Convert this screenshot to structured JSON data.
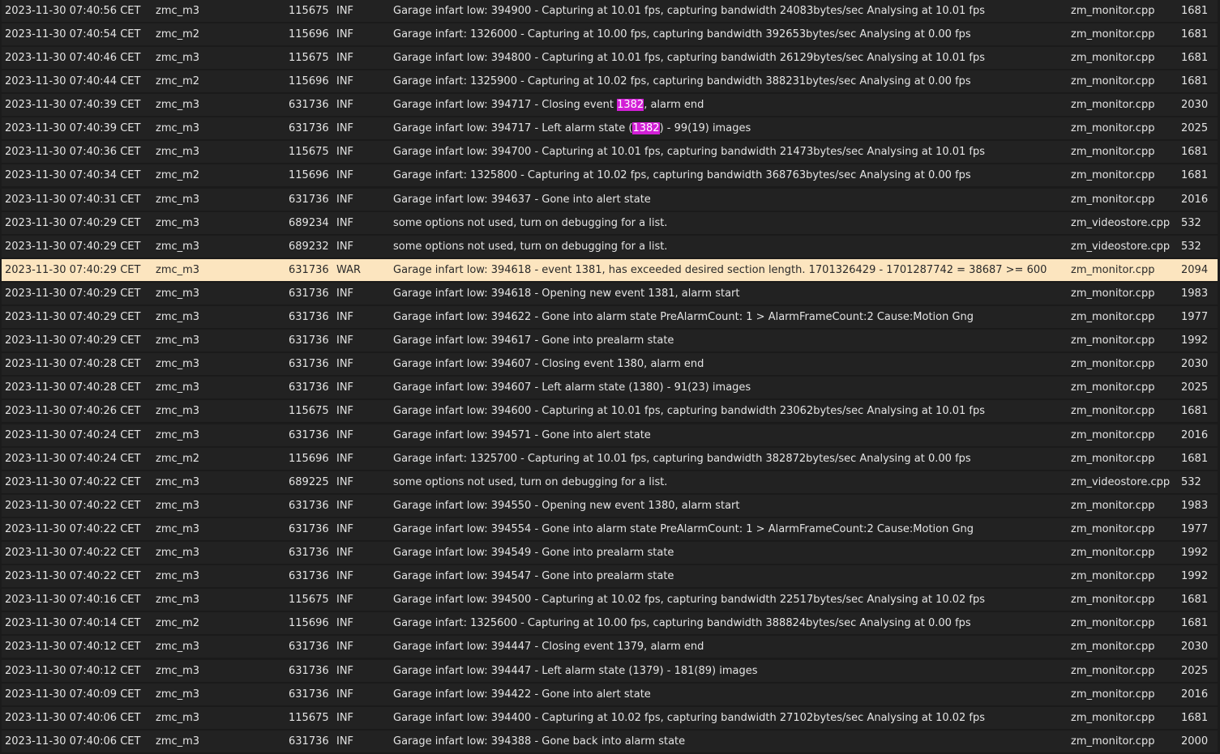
{
  "log": {
    "highlight_term": "1382",
    "highlight_color": "#d21fd6",
    "warning_row_color": "#fce5bf",
    "rows": [
      {
        "time": "2023-11-30 07:40:56 CET",
        "component": "zmc_m3",
        "pid": "115675",
        "level": "INF",
        "pre": "Garage infart low: 394900 - Capturing at 10.01 fps, capturing bandwidth 24083bytes/sec Analysing at 10.01 fps",
        "hl": "",
        "post": "",
        "file": "zm_monitor.cpp",
        "line": "1681"
      },
      {
        "time": "2023-11-30 07:40:54 CET",
        "component": "zmc_m2",
        "pid": "115696",
        "level": "INF",
        "pre": "Garage infart: 1326000 - Capturing at 10.00 fps, capturing bandwidth 392653bytes/sec Analysing at 0.00 fps",
        "hl": "",
        "post": "",
        "file": "zm_monitor.cpp",
        "line": "1681"
      },
      {
        "time": "2023-11-30 07:40:46 CET",
        "component": "zmc_m3",
        "pid": "115675",
        "level": "INF",
        "pre": "Garage infart low: 394800 - Capturing at 10.01 fps, capturing bandwidth 26129bytes/sec Analysing at 10.01 fps",
        "hl": "",
        "post": "",
        "file": "zm_monitor.cpp",
        "line": "1681"
      },
      {
        "time": "2023-11-30 07:40:44 CET",
        "component": "zmc_m2",
        "pid": "115696",
        "level": "INF",
        "pre": "Garage infart: 1325900 - Capturing at 10.02 fps, capturing bandwidth 388231bytes/sec Analysing at 0.00 fps",
        "hl": "",
        "post": "",
        "file": "zm_monitor.cpp",
        "line": "1681"
      },
      {
        "time": "2023-11-30 07:40:39 CET",
        "component": "zmc_m3",
        "pid": "631736",
        "level": "INF",
        "pre": "Garage infart low: 394717 - Closing event ",
        "hl": "1382",
        "post": ", alarm end",
        "file": "zm_monitor.cpp",
        "line": "2030"
      },
      {
        "time": "2023-11-30 07:40:39 CET",
        "component": "zmc_m3",
        "pid": "631736",
        "level": "INF",
        "pre": "Garage infart low: 394717 - Left alarm state (",
        "hl": "1382",
        "post": ") - 99(19) images",
        "file": "zm_monitor.cpp",
        "line": "2025"
      },
      {
        "time": "2023-11-30 07:40:36 CET",
        "component": "zmc_m3",
        "pid": "115675",
        "level": "INF",
        "pre": "Garage infart low: 394700 - Capturing at 10.01 fps, capturing bandwidth 21473bytes/sec Analysing at 10.01 fps",
        "hl": "",
        "post": "",
        "file": "zm_monitor.cpp",
        "line": "1681"
      },
      {
        "time": "2023-11-30 07:40:34 CET",
        "component": "zmc_m2",
        "pid": "115696",
        "level": "INF",
        "pre": "Garage infart: 1325800 - Capturing at 10.02 fps, capturing bandwidth 368763bytes/sec Analysing at 0.00 fps",
        "hl": "",
        "post": "",
        "file": "zm_monitor.cpp",
        "line": "1681"
      },
      {
        "time": "2023-11-30 07:40:31 CET",
        "component": "zmc_m3",
        "pid": "631736",
        "level": "INF",
        "pre": "Garage infart low: 394637 - Gone into alert state",
        "hl": "",
        "post": "",
        "file": "zm_monitor.cpp",
        "line": "2016"
      },
      {
        "time": "2023-11-30 07:40:29 CET",
        "component": "zmc_m3",
        "pid": "689234",
        "level": "INF",
        "pre": "some options not used, turn on debugging for a list.",
        "hl": "",
        "post": "",
        "file": "zm_videostore.cpp",
        "line": "532"
      },
      {
        "time": "2023-11-30 07:40:29 CET",
        "component": "zmc_m3",
        "pid": "689232",
        "level": "INF",
        "pre": "some options not used, turn on debugging for a list.",
        "hl": "",
        "post": "",
        "file": "zm_videostore.cpp",
        "line": "532"
      },
      {
        "time": "2023-11-30 07:40:29 CET",
        "component": "zmc_m3",
        "pid": "631736",
        "level": "WAR",
        "pre": "Garage infart low: 394618 - event 1381, has exceeded desired section length. 1701326429 - 1701287742 = 38687 >= 600",
        "hl": "",
        "post": "",
        "file": "zm_monitor.cpp",
        "line": "2094"
      },
      {
        "time": "2023-11-30 07:40:29 CET",
        "component": "zmc_m3",
        "pid": "631736",
        "level": "INF",
        "pre": "Garage infart low: 394618 - Opening new event 1381, alarm start",
        "hl": "",
        "post": "",
        "file": "zm_monitor.cpp",
        "line": "1983"
      },
      {
        "time": "2023-11-30 07:40:29 CET",
        "component": "zmc_m3",
        "pid": "631736",
        "level": "INF",
        "pre": "Garage infart low: 394622 - Gone into alarm state PreAlarmCount: 1 > AlarmFrameCount:2 Cause:Motion Gng",
        "hl": "",
        "post": "",
        "file": "zm_monitor.cpp",
        "line": "1977"
      },
      {
        "time": "2023-11-30 07:40:29 CET",
        "component": "zmc_m3",
        "pid": "631736",
        "level": "INF",
        "pre": "Garage infart low: 394617 - Gone into prealarm state",
        "hl": "",
        "post": "",
        "file": "zm_monitor.cpp",
        "line": "1992"
      },
      {
        "time": "2023-11-30 07:40:28 CET",
        "component": "zmc_m3",
        "pid": "631736",
        "level": "INF",
        "pre": "Garage infart low: 394607 - Closing event 1380, alarm end",
        "hl": "",
        "post": "",
        "file": "zm_monitor.cpp",
        "line": "2030"
      },
      {
        "time": "2023-11-30 07:40:28 CET",
        "component": "zmc_m3",
        "pid": "631736",
        "level": "INF",
        "pre": "Garage infart low: 394607 - Left alarm state (1380) - 91(23) images",
        "hl": "",
        "post": "",
        "file": "zm_monitor.cpp",
        "line": "2025"
      },
      {
        "time": "2023-11-30 07:40:26 CET",
        "component": "zmc_m3",
        "pid": "115675",
        "level": "INF",
        "pre": "Garage infart low: 394600 - Capturing at 10.01 fps, capturing bandwidth 23062bytes/sec Analysing at 10.01 fps",
        "hl": "",
        "post": "",
        "file": "zm_monitor.cpp",
        "line": "1681"
      },
      {
        "time": "2023-11-30 07:40:24 CET",
        "component": "zmc_m3",
        "pid": "631736",
        "level": "INF",
        "pre": "Garage infart low: 394571 - Gone into alert state",
        "hl": "",
        "post": "",
        "file": "zm_monitor.cpp",
        "line": "2016"
      },
      {
        "time": "2023-11-30 07:40:24 CET",
        "component": "zmc_m2",
        "pid": "115696",
        "level": "INF",
        "pre": "Garage infart: 1325700 - Capturing at 10.01 fps, capturing bandwidth 382872bytes/sec Analysing at 0.00 fps",
        "hl": "",
        "post": "",
        "file": "zm_monitor.cpp",
        "line": "1681"
      },
      {
        "time": "2023-11-30 07:40:22 CET",
        "component": "zmc_m3",
        "pid": "689225",
        "level": "INF",
        "pre": "some options not used, turn on debugging for a list.",
        "hl": "",
        "post": "",
        "file": "zm_videostore.cpp",
        "line": "532"
      },
      {
        "time": "2023-11-30 07:40:22 CET",
        "component": "zmc_m3",
        "pid": "631736",
        "level": "INF",
        "pre": "Garage infart low: 394550 - Opening new event 1380, alarm start",
        "hl": "",
        "post": "",
        "file": "zm_monitor.cpp",
        "line": "1983"
      },
      {
        "time": "2023-11-30 07:40:22 CET",
        "component": "zmc_m3",
        "pid": "631736",
        "level": "INF",
        "pre": "Garage infart low: 394554 - Gone into alarm state PreAlarmCount: 1 > AlarmFrameCount:2 Cause:Motion Gng",
        "hl": "",
        "post": "",
        "file": "zm_monitor.cpp",
        "line": "1977"
      },
      {
        "time": "2023-11-30 07:40:22 CET",
        "component": "zmc_m3",
        "pid": "631736",
        "level": "INF",
        "pre": "Garage infart low: 394549 - Gone into prealarm state",
        "hl": "",
        "post": "",
        "file": "zm_monitor.cpp",
        "line": "1992"
      },
      {
        "time": "2023-11-30 07:40:22 CET",
        "component": "zmc_m3",
        "pid": "631736",
        "level": "INF",
        "pre": "Garage infart low: 394547 - Gone into prealarm state",
        "hl": "",
        "post": "",
        "file": "zm_monitor.cpp",
        "line": "1992"
      },
      {
        "time": "2023-11-30 07:40:16 CET",
        "component": "zmc_m3",
        "pid": "115675",
        "level": "INF",
        "pre": "Garage infart low: 394500 - Capturing at 10.02 fps, capturing bandwidth 22517bytes/sec Analysing at 10.02 fps",
        "hl": "",
        "post": "",
        "file": "zm_monitor.cpp",
        "line": "1681"
      },
      {
        "time": "2023-11-30 07:40:14 CET",
        "component": "zmc_m2",
        "pid": "115696",
        "level": "INF",
        "pre": "Garage infart: 1325600 - Capturing at 10.00 fps, capturing bandwidth 388824bytes/sec Analysing at 0.00 fps",
        "hl": "",
        "post": "",
        "file": "zm_monitor.cpp",
        "line": "1681"
      },
      {
        "time": "2023-11-30 07:40:12 CET",
        "component": "zmc_m3",
        "pid": "631736",
        "level": "INF",
        "pre": "Garage infart low: 394447 - Closing event 1379, alarm end",
        "hl": "",
        "post": "",
        "file": "zm_monitor.cpp",
        "line": "2030"
      },
      {
        "time": "2023-11-30 07:40:12 CET",
        "component": "zmc_m3",
        "pid": "631736",
        "level": "INF",
        "pre": "Garage infart low: 394447 - Left alarm state (1379) - 181(89) images",
        "hl": "",
        "post": "",
        "file": "zm_monitor.cpp",
        "line": "2025"
      },
      {
        "time": "2023-11-30 07:40:09 CET",
        "component": "zmc_m3",
        "pid": "631736",
        "level": "INF",
        "pre": "Garage infart low: 394422 - Gone into alert state",
        "hl": "",
        "post": "",
        "file": "zm_monitor.cpp",
        "line": "2016"
      },
      {
        "time": "2023-11-30 07:40:06 CET",
        "component": "zmc_m3",
        "pid": "115675",
        "level": "INF",
        "pre": "Garage infart low: 394400 - Capturing at 10.02 fps, capturing bandwidth 27102bytes/sec Analysing at 10.02 fps",
        "hl": "",
        "post": "",
        "file": "zm_monitor.cpp",
        "line": "1681"
      },
      {
        "time": "2023-11-30 07:40:06 CET",
        "component": "zmc_m3",
        "pid": "631736",
        "level": "INF",
        "pre": "Garage infart low: 394388 - Gone back into alarm state",
        "hl": "",
        "post": "",
        "file": "zm_monitor.cpp",
        "line": "2000"
      }
    ]
  }
}
